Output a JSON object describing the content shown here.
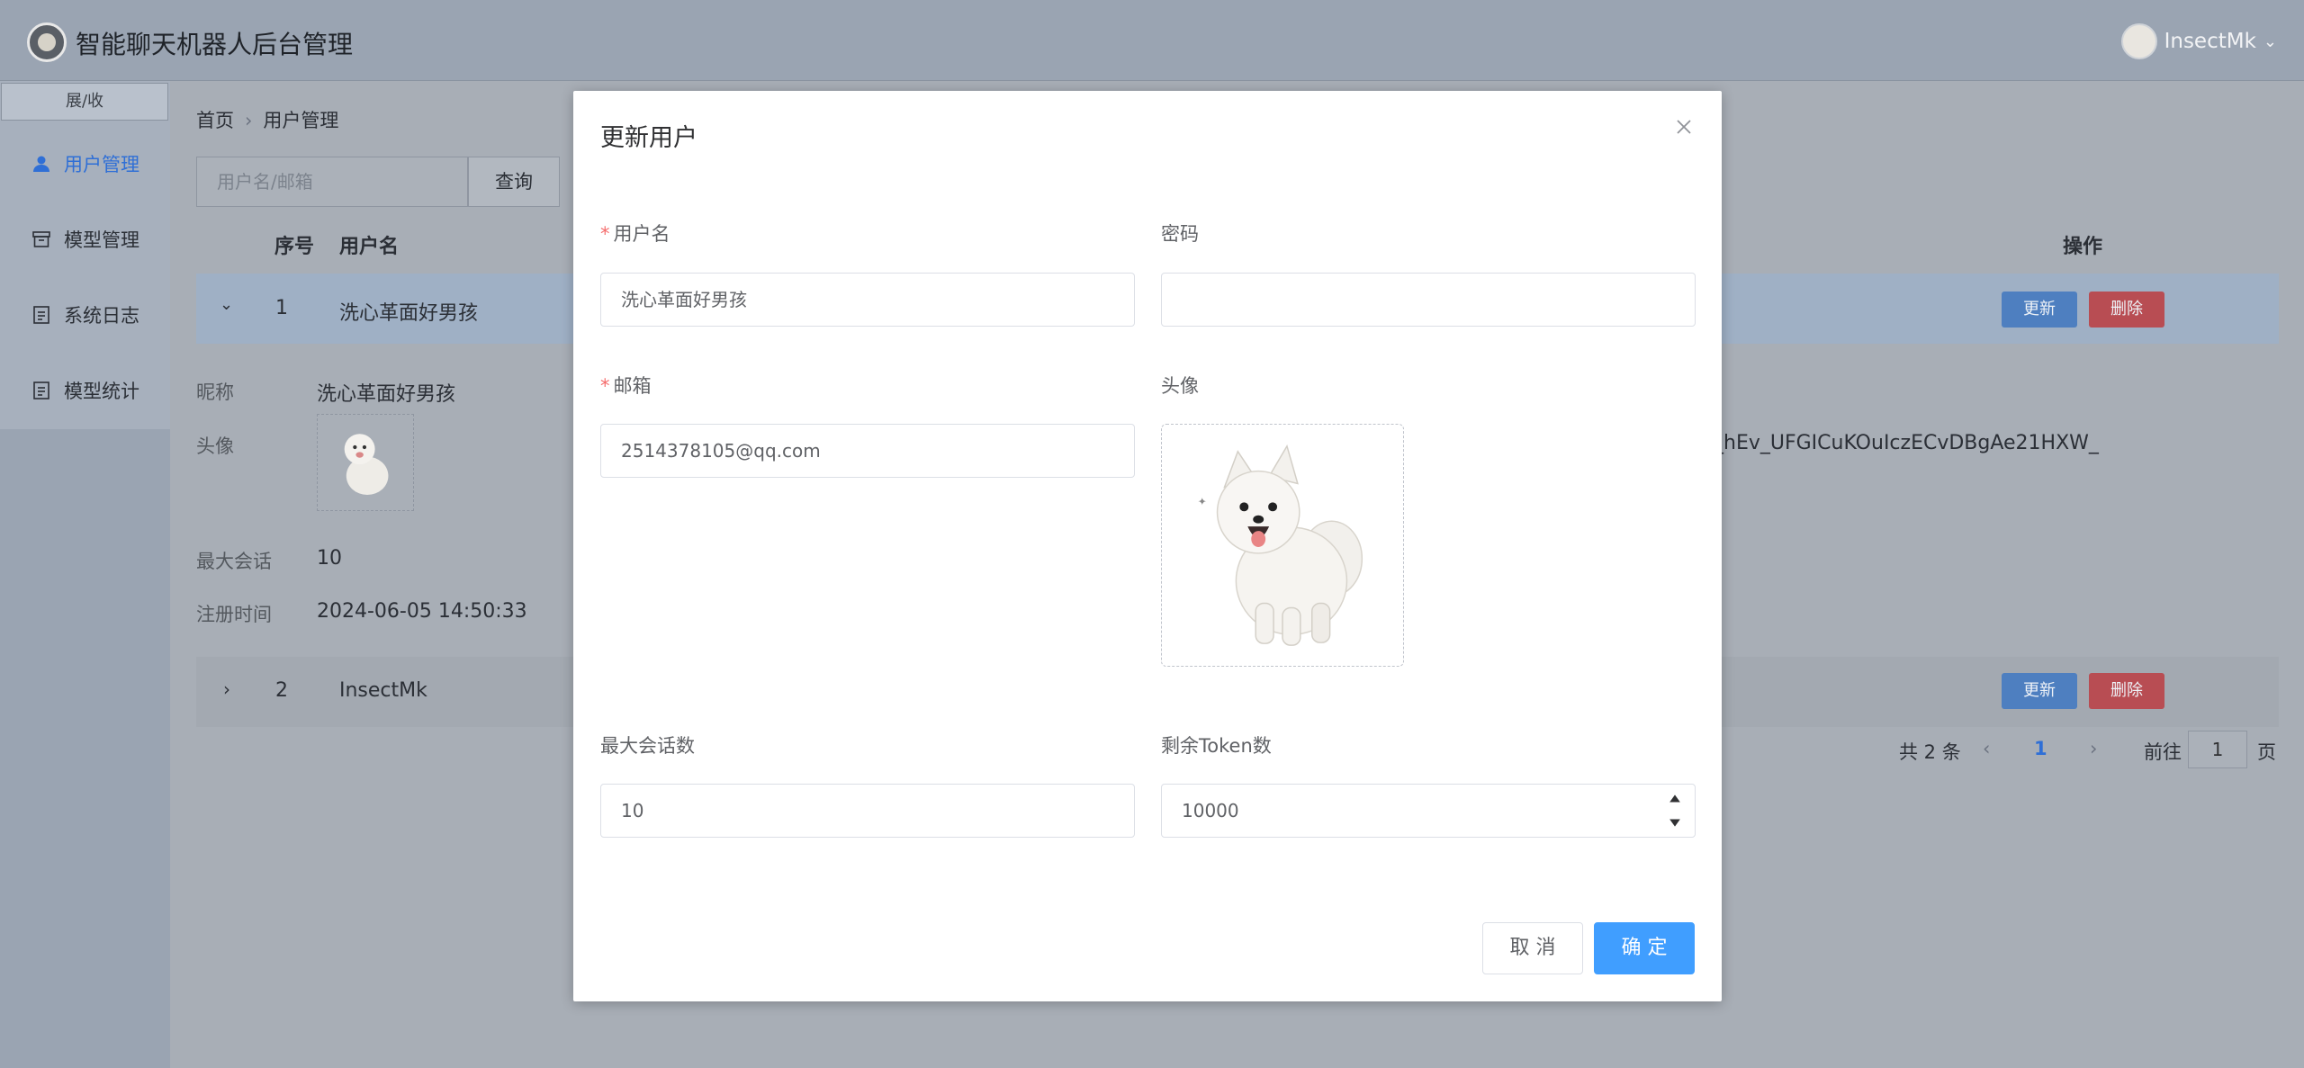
{
  "header": {
    "title": "智能聊天机器人后台管理",
    "user_name": "InsectMk"
  },
  "sidebar": {
    "collapse_label": "展/收",
    "items": [
      {
        "label": "用户管理",
        "icon": "user-icon",
        "active": true
      },
      {
        "label": "模型管理",
        "icon": "box-icon"
      },
      {
        "label": "系统日志",
        "icon": "document-icon"
      },
      {
        "label": "模型统计",
        "icon": "document-icon"
      }
    ]
  },
  "breadcrumb": {
    "home": "首页",
    "current": "用户管理"
  },
  "search": {
    "placeholder": "用户名/邮箱",
    "button": "查询"
  },
  "table": {
    "headers": {
      "index": "序号",
      "username": "用户名",
      "actions": "操作"
    },
    "rows": [
      {
        "index": "1",
        "username": "洗心革面好男孩"
      },
      {
        "index": "2",
        "username": "InsectMk"
      }
    ],
    "update_label": "更新",
    "delete_label": "删除"
  },
  "detail": {
    "nickname_label": "昵称",
    "nickname": "洗心革面好男孩",
    "avatar_label": "头像",
    "max_session_label": "最大会话",
    "max_session": "10",
    "register_label": "注册时间",
    "register_time": "2024-06-05 14:50:33",
    "extra_text": "_hEv_UFGICuKOuIczECvDBgAe21HXW_"
  },
  "pagination": {
    "total": "共 2 条",
    "current_page": "1",
    "goto_prefix": "前往",
    "goto_value": "1",
    "goto_suffix": "页"
  },
  "dialog": {
    "title": "更新用户",
    "username_label": "用户名",
    "username_value": "洗心革面好男孩",
    "password_label": "密码",
    "password_value": "",
    "email_label": "邮箱",
    "email_value": "2514378105@qq.com",
    "avatar_label": "头像",
    "max_session_label": "最大会话数",
    "max_session_value": "10",
    "token_label": "剩余Token数",
    "token_value": "10000",
    "cancel": "取 消",
    "confirm": "确 定"
  },
  "colors": {
    "primary": "#409eff",
    "danger": "#f56c6c",
    "overlay": "#6b7380"
  }
}
